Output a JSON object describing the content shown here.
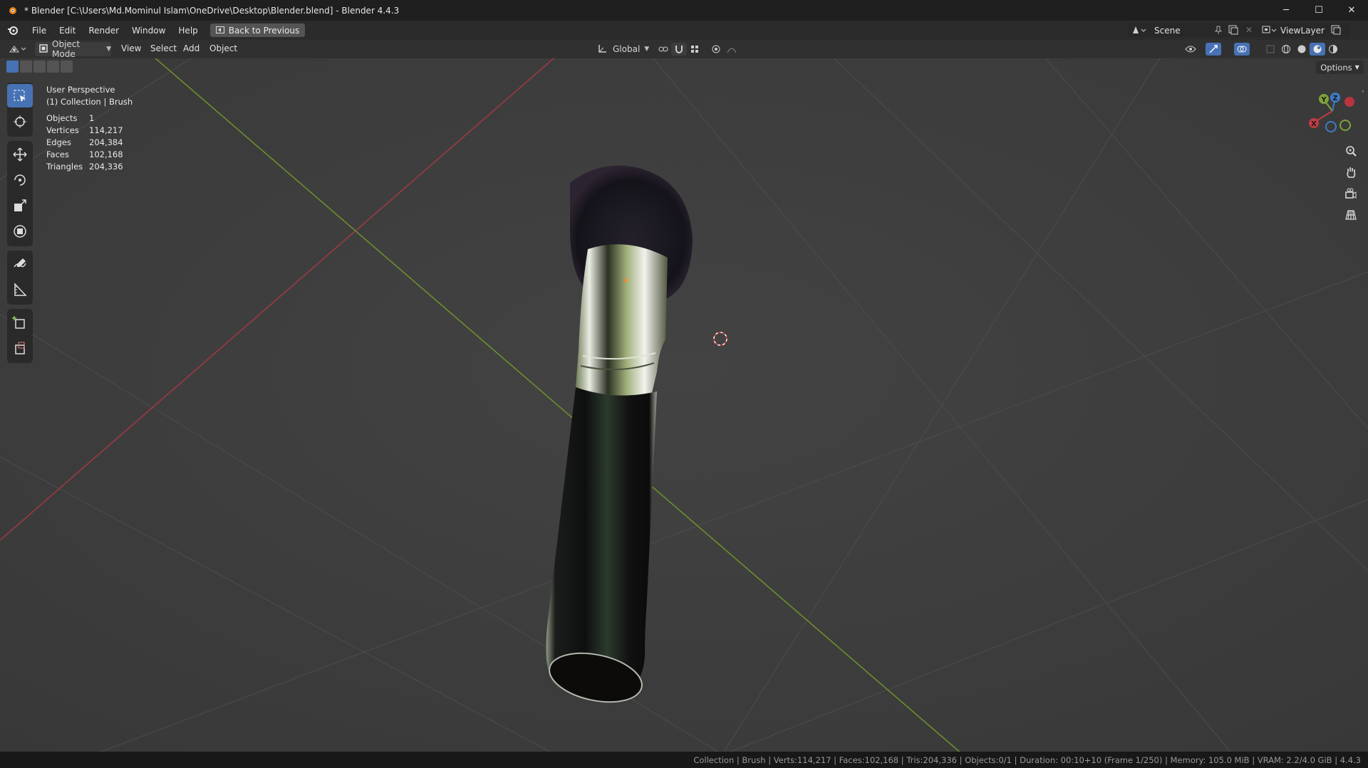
{
  "window": {
    "title": "* Blender [C:\\Users\\Md.Mominul Islam\\OneDrive\\Desktop\\Blender.blend] - Blender 4.4.3",
    "minimize": "─",
    "maximize": "☐",
    "close": "✕"
  },
  "menubar": {
    "items": [
      "File",
      "Edit",
      "Render",
      "Window",
      "Help"
    ],
    "back_button": "Back to Previous",
    "scene": "Scene",
    "view_layer": "ViewLayer"
  },
  "header": {
    "mode": "Object Mode",
    "menus": [
      "View",
      "Select",
      "Add",
      "Object"
    ],
    "transform_orientation": "Global",
    "options": "Options"
  },
  "overlay": {
    "perspective": "User Perspective",
    "collection": "(1) Collection | Brush",
    "stats": [
      {
        "label": "Objects",
        "value": "1"
      },
      {
        "label": "Vertices",
        "value": "114,217"
      },
      {
        "label": "Edges",
        "value": "204,384"
      },
      {
        "label": "Faces",
        "value": "102,168"
      },
      {
        "label": "Triangles",
        "value": "204,336"
      }
    ]
  },
  "gizmo": {
    "y": "Y",
    "z": "Z",
    "x": "X"
  },
  "statusbar": {
    "text": "Collection | Brush | Verts:114,217 | Faces:102,168 | Tris:204,336 | Objects:0/1 | Duration: 00:10+10 (Frame 1/250) | Memory: 105.0 MiB | VRAM: 2.2/4.0 GiB | 4.4.3"
  },
  "colors": {
    "accent": "#4772b3",
    "x_axis": "#c23b45",
    "y_axis": "#7ea13a",
    "z_axis": "#3f7bc4"
  }
}
